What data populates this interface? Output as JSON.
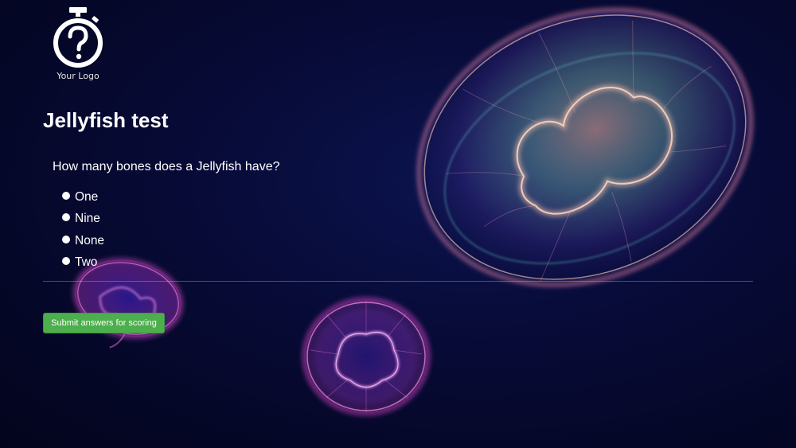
{
  "logo": {
    "icon": "stopwatch-question-icon",
    "text": "Your Logo"
  },
  "quiz": {
    "title": "Jellyfish test",
    "question": "How many bones does a Jellyfish have?",
    "options": [
      {
        "label": "One",
        "selected": false
      },
      {
        "label": "Nine",
        "selected": false
      },
      {
        "label": "None",
        "selected": false
      },
      {
        "label": "Two",
        "selected": false
      }
    ]
  },
  "submit": {
    "label": "Submit answers for scoring"
  },
  "colors": {
    "background": "#070a35",
    "accent_button": "#4cae4c",
    "text": "#ffffff"
  }
}
